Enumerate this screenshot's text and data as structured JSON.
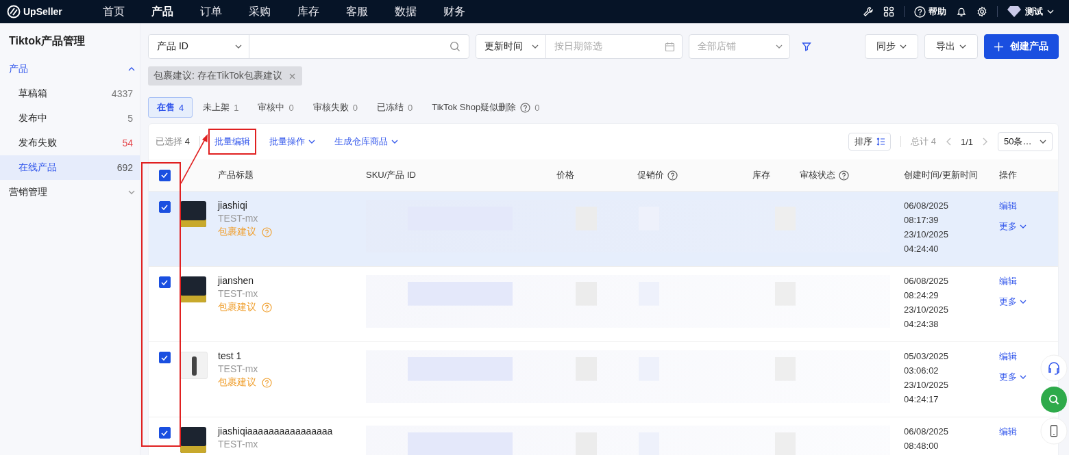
{
  "topbar": {
    "logo": "UpSeller",
    "help": "帮助",
    "user": "测试",
    "nav": [
      {
        "label": "首页",
        "selected": false
      },
      {
        "label": "产品",
        "selected": true
      },
      {
        "label": "订单",
        "selected": false
      },
      {
        "label": "采购",
        "selected": false
      },
      {
        "label": "库存",
        "selected": false
      },
      {
        "label": "客服",
        "selected": false
      },
      {
        "label": "数据",
        "selected": false
      },
      {
        "label": "财务",
        "selected": false
      }
    ]
  },
  "sidebar": {
    "title": "Tiktok产品管理",
    "groups": [
      {
        "label": "产品",
        "expanded": true,
        "children": [
          {
            "label": "草稿箱",
            "count": "4337",
            "alert": false,
            "selected": false
          },
          {
            "label": "发布中",
            "count": "5",
            "alert": false,
            "selected": false
          },
          {
            "label": "发布失败",
            "count": "54",
            "alert": true,
            "selected": false
          },
          {
            "label": "在线产品",
            "count": "692",
            "alert": false,
            "selected": true
          }
        ]
      },
      {
        "label": "营销管理",
        "expanded": false
      }
    ]
  },
  "filters": {
    "search_type": "产品 ID",
    "date_type": "更新时间",
    "date_placeholder": "按日期筛选",
    "shop_placeholder": "全部店铺",
    "menus": [
      "同步",
      "导出"
    ],
    "create": "创建产品"
  },
  "filter_tags": [
    {
      "label": "包裹建议: 存在TikTok包裹建议"
    }
  ],
  "status_tabs": [
    {
      "label": "在售",
      "count": "4",
      "selected": true,
      "help": false
    },
    {
      "label": "未上架",
      "count": "1",
      "selected": false,
      "help": false
    },
    {
      "label": "审核中",
      "count": "0",
      "selected": false,
      "help": false
    },
    {
      "label": "审核失败",
      "count": "0",
      "selected": false,
      "help": false
    },
    {
      "label": "已冻结",
      "count": "0",
      "selected": false,
      "help": false
    },
    {
      "label": "TikTok Shop疑似删除",
      "count": "0",
      "selected": false,
      "help": true
    }
  ],
  "toolbar": {
    "selected_label": "已选择",
    "selected_count": "4",
    "sort": "排序",
    "total": "总计 4",
    "page": "1/1",
    "page_size": "50条…",
    "actions": [
      {
        "label": "批量编辑",
        "dropdown": false,
        "highlighted": true
      },
      {
        "label": "批量操作",
        "dropdown": true,
        "highlighted": false
      },
      {
        "label": "生成仓库商品",
        "dropdown": true,
        "highlighted": false
      }
    ]
  },
  "table": {
    "select_all": true,
    "columns": [
      {
        "label": "产品标题",
        "help": false
      },
      {
        "label": "SKU/产品 ID",
        "help": false
      },
      {
        "label": "价格",
        "help": false
      },
      {
        "label": "促销价",
        "help": true
      },
      {
        "label": "库存",
        "help": false
      },
      {
        "label": "审核状态",
        "help": true
      },
      {
        "label": "创建时间/更新时间",
        "help": false
      },
      {
        "label": "操作",
        "help": false
      }
    ],
    "rows": [
      {
        "checked": true,
        "hovered": true,
        "kind": "product",
        "title": "jiashiqi",
        "store": "TEST-mx",
        "tag": "包裹建议",
        "times": [
          "06/08/2025",
          "08:17:39",
          "23/10/2025",
          "04:24:40"
        ],
        "actions": [
          "编辑",
          "更多"
        ]
      },
      {
        "checked": true,
        "hovered": false,
        "kind": "product",
        "title": "jianshen",
        "store": "TEST-mx",
        "tag": "包裹建议",
        "times": [
          "06/08/2025",
          "08:24:29",
          "23/10/2025",
          "04:24:38"
        ],
        "actions": [
          "编辑",
          "更多"
        ]
      },
      {
        "checked": true,
        "hovered": false,
        "kind": "person",
        "title": "test 1",
        "store": "TEST-mx",
        "tag": "包裹建议",
        "times": [
          "05/03/2025",
          "03:06:02",
          "23/10/2025",
          "04:24:17"
        ],
        "actions": [
          "编辑",
          "更多"
        ]
      },
      {
        "checked": true,
        "hovered": false,
        "kind": "product",
        "title": "jiashiqiaaaaaaaaaaaaaaaa",
        "store": "TEST-mx",
        "times": [
          "06/08/2025",
          "08:48:00"
        ],
        "actions": [
          "编辑"
        ]
      }
    ]
  }
}
